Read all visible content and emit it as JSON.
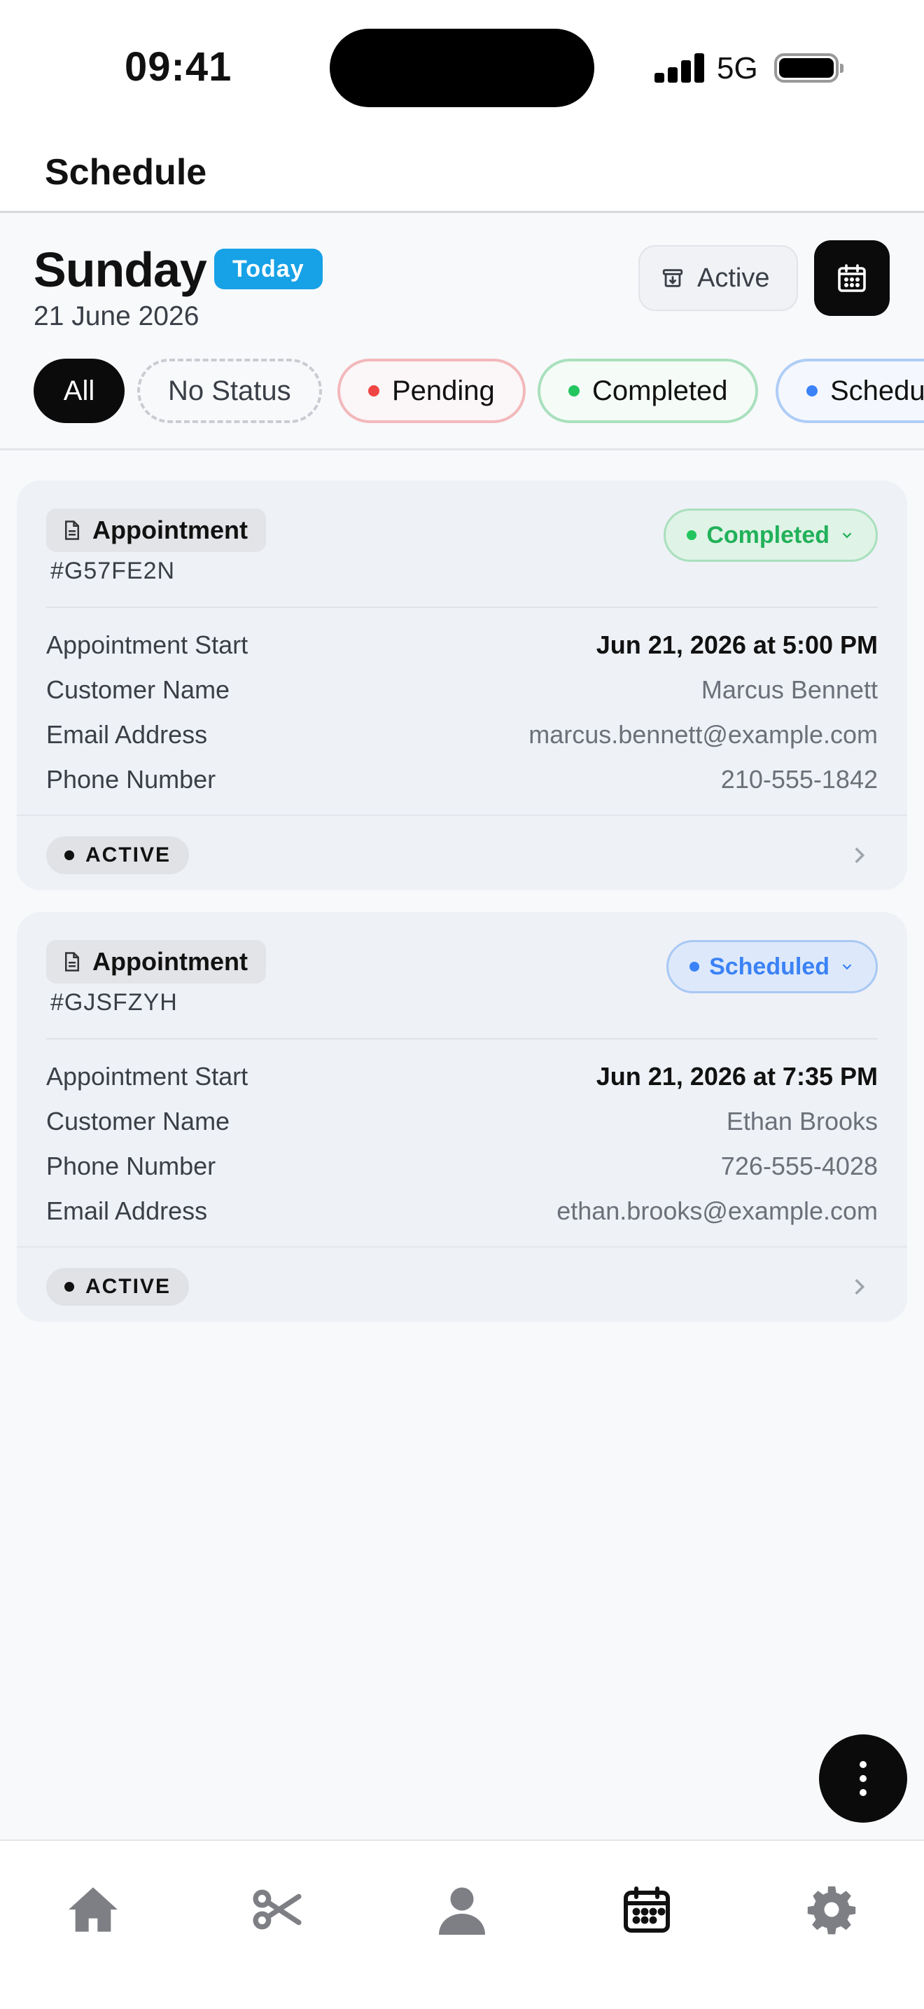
{
  "status_bar": {
    "time": "09:41",
    "network": "5G"
  },
  "header": {
    "title": "Schedule"
  },
  "day": {
    "name": "Sunday",
    "today_badge": "Today",
    "date": "21 June 2026"
  },
  "toolbar": {
    "active_filter_label": "Active"
  },
  "filters": [
    {
      "label": "All",
      "selected": true
    },
    {
      "label": "No Status"
    },
    {
      "label": "Pending",
      "color": "#ef4444"
    },
    {
      "label": "Completed",
      "color": "#22c55e"
    },
    {
      "label": "Scheduled",
      "color": "#3b82f6"
    }
  ],
  "appointments": [
    {
      "type": "Appointment",
      "id": "#G57FE2N",
      "status": "Completed",
      "fields": [
        {
          "label": "Appointment Start",
          "value": "Jun 21, 2026 at 5:00 PM"
        },
        {
          "label": "Customer Name",
          "value": "Marcus Bennett"
        },
        {
          "label": "Email Address",
          "value": "marcus.bennett@example.com"
        },
        {
          "label": "Phone Number",
          "value": "210-555-1842"
        }
      ],
      "tag": "ACTIVE"
    },
    {
      "type": "Appointment",
      "id": "#GJSFZYH",
      "status": "Scheduled",
      "fields": [
        {
          "label": "Appointment Start",
          "value": "Jun 21, 2026 at 7:35 PM"
        },
        {
          "label": "Customer Name",
          "value": "Ethan Brooks"
        },
        {
          "label": "Phone Number",
          "value": "726-555-4028"
        },
        {
          "label": "Email Address",
          "value": "ethan.brooks@example.com"
        }
      ],
      "tag": "ACTIVE"
    }
  ],
  "tab_bar": {
    "items": [
      {
        "icon": "home-icon"
      },
      {
        "icon": "scissors-icon"
      },
      {
        "icon": "person-icon"
      },
      {
        "icon": "calendar-icon",
        "selected": true
      },
      {
        "icon": "gear-icon"
      }
    ]
  }
}
